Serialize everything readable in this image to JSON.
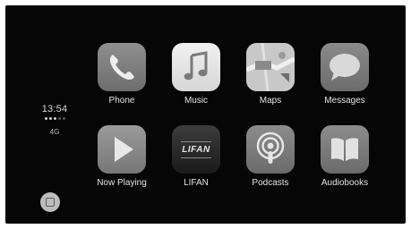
{
  "status": {
    "time": "13:54",
    "network": "4G"
  },
  "apps": [
    {
      "label": "Phone",
      "icon": "phone-icon"
    },
    {
      "label": "Music",
      "icon": "music-note-icon"
    },
    {
      "label": "Maps",
      "icon": "map-icon"
    },
    {
      "label": "Messages",
      "icon": "speech-bubble-icon"
    },
    {
      "label": "Now Playing",
      "icon": "play-icon"
    },
    {
      "label": "LIFAN",
      "icon": "lifan-logo-icon",
      "logo_text": "LIFAN"
    },
    {
      "label": "Podcasts",
      "icon": "podcast-icon"
    },
    {
      "label": "Audiobooks",
      "icon": "book-icon"
    }
  ],
  "colors": {
    "screen": "#060606",
    "label": "#e4e4e4"
  }
}
